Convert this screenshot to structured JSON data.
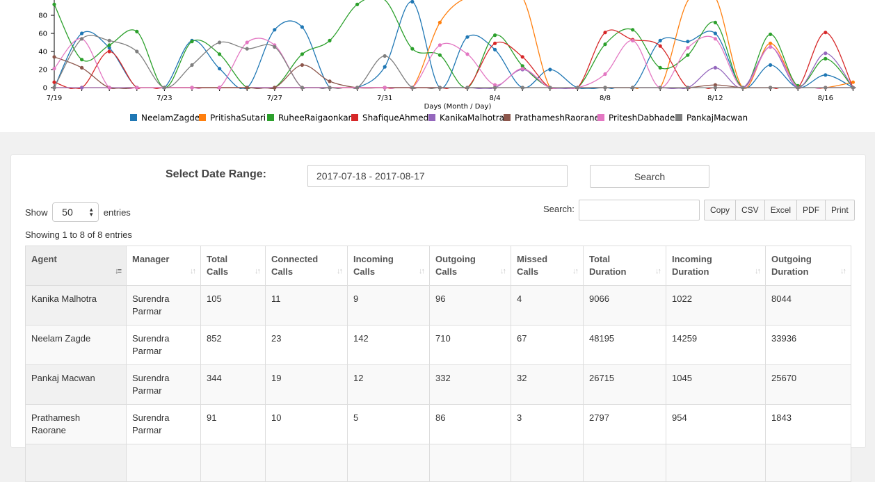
{
  "chart_data": {
    "type": "line",
    "xlabel": "Days (Month / Day)",
    "ylabel": "",
    "ylim": [
      0,
      100
    ],
    "y_ticks": [
      "0",
      "20",
      "40",
      "60",
      "80"
    ],
    "x_ticks": [
      {
        "day": 0,
        "label": "7/19"
      },
      {
        "day": 4,
        "label": "7/23"
      },
      {
        "day": 8,
        "label": "7/27"
      },
      {
        "day": 12,
        "label": "7/31"
      },
      {
        "day": 16,
        "label": "8/4"
      },
      {
        "day": 20,
        "label": "8/8"
      },
      {
        "day": 24,
        "label": "8/12"
      },
      {
        "day": 28,
        "label": "8/16"
      }
    ],
    "x": [
      "7/19",
      "7/20",
      "7/21",
      "7/22",
      "7/23",
      "7/24",
      "7/25",
      "7/26",
      "7/27",
      "7/28",
      "7/29",
      "7/30",
      "7/31",
      "8/1",
      "8/2",
      "8/3",
      "8/4",
      "8/5",
      "8/6",
      "8/7",
      "8/8",
      "8/9",
      "8/10",
      "8/11",
      "8/12",
      "8/13",
      "8/14",
      "8/15",
      "8/16",
      "8/17"
    ],
    "series": [
      {
        "name": "NeelamZagde",
        "color": "#1f77b4",
        "values": [
          0,
          60,
          44,
          0,
          0,
          52,
          21,
          0,
          64,
          67,
          0,
          0,
          23,
          95,
          0,
          56,
          42,
          0,
          20,
          0,
          0,
          0,
          52,
          51,
          60,
          0,
          25,
          0,
          14,
          0
        ]
      },
      {
        "name": "PritishaSutari",
        "color": "#ff7f0e",
        "values": [
          0,
          0,
          0,
          0,
          0,
          0,
          0,
          0,
          0,
          0,
          0,
          0,
          0,
          0,
          72,
          100,
          100,
          100,
          0,
          0,
          0,
          0,
          0,
          96,
          100,
          0,
          49,
          0,
          0,
          6
        ]
      },
      {
        "name": "RuheeRaigaonkar",
        "color": "#2ca02c",
        "values": [
          92,
          31,
          47,
          62,
          0,
          51,
          37,
          0,
          0,
          37,
          52,
          92,
          97,
          43,
          36,
          0,
          58,
          24,
          0,
          0,
          48,
          64,
          22,
          36,
          72,
          0,
          59,
          2,
          32,
          0
        ]
      },
      {
        "name": "ShafiqueAhmed",
        "color": "#d62728",
        "values": [
          6,
          0,
          40,
          0,
          0,
          0,
          0,
          0,
          0,
          0,
          0,
          0,
          0,
          0,
          0,
          0,
          49,
          34,
          0,
          0,
          61,
          53,
          46,
          0,
          0,
          0,
          0,
          0,
          61,
          0
        ]
      },
      {
        "name": "KanikaMalhotra",
        "color": "#9467bd",
        "values": [
          0,
          0,
          0,
          0,
          0,
          0,
          0,
          0,
          0,
          0,
          0,
          0,
          0,
          0,
          0,
          0,
          0,
          20,
          0,
          0,
          0,
          0,
          0,
          0,
          22,
          0,
          45,
          0,
          38,
          0
        ]
      },
      {
        "name": "PrathameshRaorane",
        "color": "#8c564b",
        "values": [
          34,
          22,
          0,
          0,
          0,
          0,
          0,
          0,
          0,
          25,
          7,
          0,
          0,
          0,
          0,
          0,
          0,
          0,
          0,
          0,
          0,
          0,
          0,
          0,
          3,
          0,
          0,
          0,
          0,
          0
        ]
      },
      {
        "name": "PriteshDabhade",
        "color": "#e377c2",
        "values": [
          21,
          54,
          0,
          0,
          0,
          0,
          0,
          50,
          47,
          0,
          0,
          0,
          0,
          0,
          47,
          37,
          3,
          21,
          0,
          0,
          15,
          52,
          0,
          44,
          54,
          0,
          45,
          0,
          0,
          0
        ]
      },
      {
        "name": "PankajMacwan",
        "color": "#7f7f7f",
        "values": [
          0,
          54,
          52,
          40,
          0,
          25,
          50,
          43,
          45,
          0,
          0,
          0,
          35,
          0,
          0,
          0,
          0,
          0,
          0,
          0,
          0,
          0,
          0,
          0,
          0,
          0,
          0,
          0,
          0,
          0
        ]
      }
    ]
  },
  "filters": {
    "date_label": "Select Date Range:",
    "date_value": "2017-07-18 - 2017-08-17",
    "search_button": "Search"
  },
  "table_controls": {
    "show_label": "Show",
    "page_length": "50",
    "entries_label": "entries",
    "search_label": "Search:",
    "search_value": "",
    "export_buttons": [
      "Copy",
      "CSV",
      "Excel",
      "PDF",
      "Print"
    ],
    "info": "Showing 1 to 8 of 8 entries"
  },
  "table": {
    "columns": [
      {
        "line1": "Agent",
        "line2": ""
      },
      {
        "line1": "Manager",
        "line2": ""
      },
      {
        "line1": "Total",
        "line2": "Calls"
      },
      {
        "line1": "Connected",
        "line2": "Calls"
      },
      {
        "line1": "Incoming",
        "line2": "Calls"
      },
      {
        "line1": "Outgoing",
        "line2": "Calls"
      },
      {
        "line1": "Missed",
        "line2": "Calls"
      },
      {
        "line1": "Total",
        "line2": "Duration"
      },
      {
        "line1": "Incoming",
        "line2": "Duration"
      },
      {
        "line1": "Outgoing",
        "line2": "Duration"
      }
    ],
    "rows": [
      [
        {
          "l1": "Kanika Malhotra",
          "l2": ""
        },
        {
          "l1": "Surendra",
          "l2": "Parmar"
        },
        {
          "l1": "105",
          "l2": ""
        },
        {
          "l1": "11",
          "l2": ""
        },
        {
          "l1": "9",
          "l2": ""
        },
        {
          "l1": "96",
          "l2": ""
        },
        {
          "l1": "4",
          "l2": ""
        },
        {
          "l1": "9066",
          "l2": ""
        },
        {
          "l1": "1022",
          "l2": ""
        },
        {
          "l1": "8044",
          "l2": ""
        }
      ],
      [
        {
          "l1": "Neelam Zagde",
          "l2": ""
        },
        {
          "l1": "Surendra",
          "l2": "Parmar"
        },
        {
          "l1": "852",
          "l2": ""
        },
        {
          "l1": "23",
          "l2": ""
        },
        {
          "l1": "142",
          "l2": ""
        },
        {
          "l1": "710",
          "l2": ""
        },
        {
          "l1": "67",
          "l2": ""
        },
        {
          "l1": "48195",
          "l2": ""
        },
        {
          "l1": "14259",
          "l2": ""
        },
        {
          "l1": "33936",
          "l2": ""
        }
      ],
      [
        {
          "l1": "Pankaj Macwan",
          "l2": ""
        },
        {
          "l1": "Surendra",
          "l2": "Parmar"
        },
        {
          "l1": "344",
          "l2": ""
        },
        {
          "l1": "19",
          "l2": ""
        },
        {
          "l1": "12",
          "l2": ""
        },
        {
          "l1": "332",
          "l2": ""
        },
        {
          "l1": "32",
          "l2": ""
        },
        {
          "l1": "26715",
          "l2": ""
        },
        {
          "l1": "1045",
          "l2": ""
        },
        {
          "l1": "25670",
          "l2": ""
        }
      ],
      [
        {
          "l1": "Prathamesh",
          "l2": "Raorane"
        },
        {
          "l1": "Surendra",
          "l2": "Parmar"
        },
        {
          "l1": "91",
          "l2": ""
        },
        {
          "l1": "10",
          "l2": ""
        },
        {
          "l1": "5",
          "l2": ""
        },
        {
          "l1": "86",
          "l2": ""
        },
        {
          "l1": "3",
          "l2": ""
        },
        {
          "l1": "2797",
          "l2": ""
        },
        {
          "l1": "954",
          "l2": ""
        },
        {
          "l1": "1843",
          "l2": ""
        }
      ],
      [
        {
          "l1": "",
          "l2": ""
        },
        {
          "l1": "",
          "l2": ""
        },
        {
          "l1": "",
          "l2": ""
        },
        {
          "l1": "",
          "l2": ""
        },
        {
          "l1": "",
          "l2": ""
        },
        {
          "l1": "",
          "l2": ""
        },
        {
          "l1": "",
          "l2": ""
        },
        {
          "l1": "",
          "l2": ""
        },
        {
          "l1": "",
          "l2": ""
        },
        {
          "l1": "",
          "l2": ""
        }
      ]
    ]
  }
}
